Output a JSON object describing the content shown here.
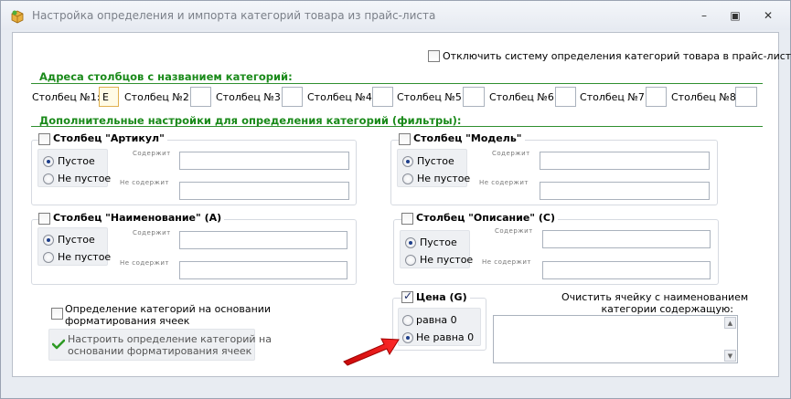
{
  "window": {
    "title": "Настройка определения и импорта категорий товара из прайс-листа",
    "controls": {
      "minimize": "–",
      "restore": "▣",
      "close": "✕"
    }
  },
  "disable_system": {
    "label": "Отключить систему определения категорий товара в прайс-листе",
    "checked": false
  },
  "columns": {
    "heading": "Адреса столбцов с названием категорий:",
    "items": [
      {
        "label": "Столбец №1:",
        "value": "E"
      },
      {
        "label": "Столбец №2:",
        "value": ""
      },
      {
        "label": "Столбец №3:",
        "value": ""
      },
      {
        "label": "Столбец №4:",
        "value": ""
      },
      {
        "label": "Столбец №5:",
        "value": ""
      },
      {
        "label": "Столбец №6:",
        "value": ""
      },
      {
        "label": "Столбец №7:",
        "value": ""
      },
      {
        "label": "Столбец №8:",
        "value": ""
      }
    ]
  },
  "filters": {
    "heading": "Дополнительные настройки для определения категорий (фильтры):",
    "contains_label": "Содержит",
    "not_contains_label": "Не содержит",
    "empty_label": "Пустое",
    "not_empty_label": "Не пустое",
    "article": {
      "title": "Столбец \"Артикул\""
    },
    "model": {
      "title": "Столбец \"Модель\""
    },
    "name": {
      "title": "Столбец \"Наименование\" (A)"
    },
    "description": {
      "title": "Столбец \"Описание\" (C)"
    },
    "price": {
      "title": "Цена (G)",
      "equal_label": "равна 0",
      "not_equal_label": "Не равна 0"
    }
  },
  "formatting": {
    "checkbox_label_line1": "Определение категорий на основании",
    "checkbox_label_line2": "форматирования ячеек",
    "button_line1": "Настроить определение категорий на",
    "button_line2": "основании форматирования ячеек"
  },
  "clear_cell": {
    "label_line1": "Очистить ячейку с наименованием",
    "label_line2": "категории содержащую:"
  },
  "colors": {
    "accent_green": "#1a8a1a",
    "arrow_red": "#e01010"
  }
}
